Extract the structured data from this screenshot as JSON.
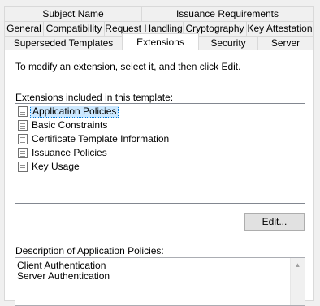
{
  "tabs": {
    "row1": [
      "Subject Name",
      "Issuance Requirements"
    ],
    "row2": [
      "General",
      "Compatibility",
      "Request Handling",
      "Cryptography",
      "Key Attestation"
    ],
    "row3": [
      "Superseded Templates",
      "Extensions",
      "Security",
      "Server"
    ]
  },
  "active_tab": "Extensions",
  "panel": {
    "instruction": "To modify an extension, select it, and then click Edit.",
    "list_label": "Extensions included in this template:",
    "extensions": [
      {
        "label": "Application Policies",
        "selected": true
      },
      {
        "label": "Basic Constraints",
        "selected": false
      },
      {
        "label": "Certificate Template Information",
        "selected": false
      },
      {
        "label": "Issuance Policies",
        "selected": false
      },
      {
        "label": "Key Usage",
        "selected": false
      }
    ],
    "edit_button": "Edit...",
    "description_label": "Description of Application Policies:",
    "description_lines": [
      "Client Authentication",
      "Server Authentication"
    ]
  },
  "colors": {
    "selection": "#cce8ff",
    "focus_border": "#0078d7",
    "dialog_bg": "#f0f0f0"
  },
  "icons": {
    "extension_item": "extension-document-icon",
    "scroll_up": "scroll-up-arrow-icon"
  }
}
